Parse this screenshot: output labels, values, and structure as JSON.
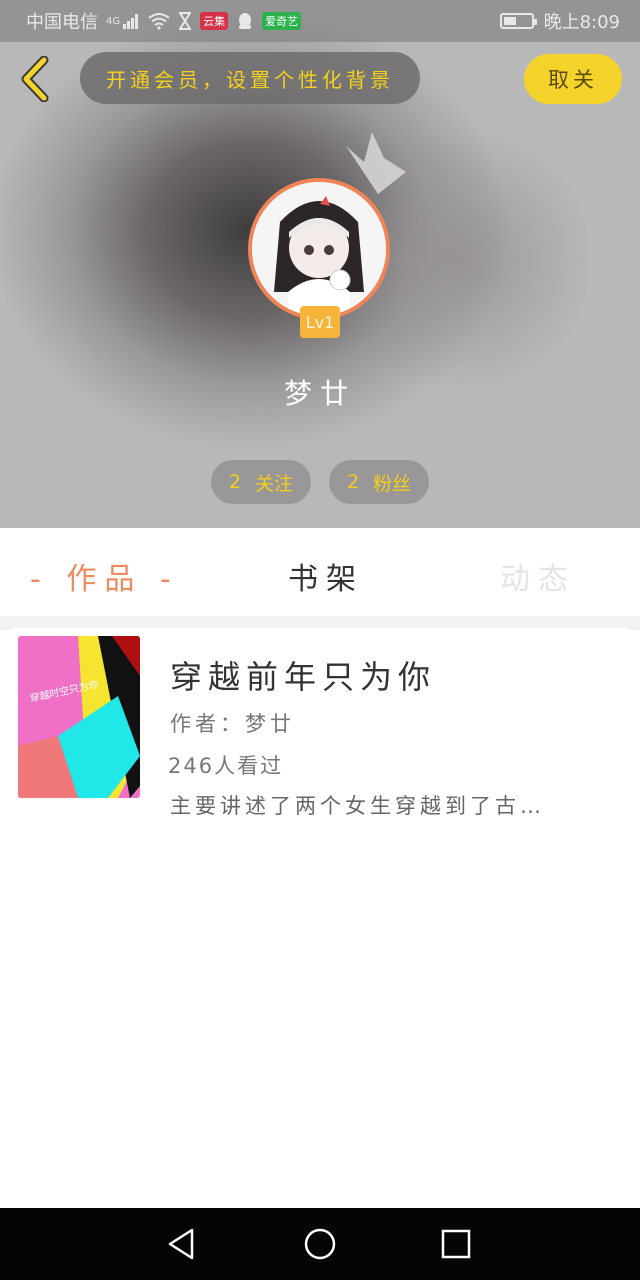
{
  "status_bar": {
    "carrier": "中国电信",
    "network": "4G",
    "badge_red": "云集",
    "badge_green": "爱奇艺",
    "time": "晚上8:09"
  },
  "header": {
    "vip_banner": "开通会员，设置个性化背景",
    "cancel_label": "取关"
  },
  "profile": {
    "level": "Lv1",
    "username": "梦廿",
    "follow_count": "2",
    "follow_label": "关注",
    "fans_count": "2",
    "fans_label": "粉丝"
  },
  "tabs": {
    "works": "- 作品 -",
    "shelf": "书架",
    "activity": "动态"
  },
  "book": {
    "title": "穿越前年只为你",
    "author": "作者：梦廿",
    "views": "246人看过",
    "description": "主要讲述了两个女生穿越到了古…",
    "cover_text": "穿越时空只为你"
  },
  "colors": {
    "accent_yellow": "#f4d42a",
    "tab_active": "#ef8a5e",
    "avatar_ring": "#ef8457"
  }
}
